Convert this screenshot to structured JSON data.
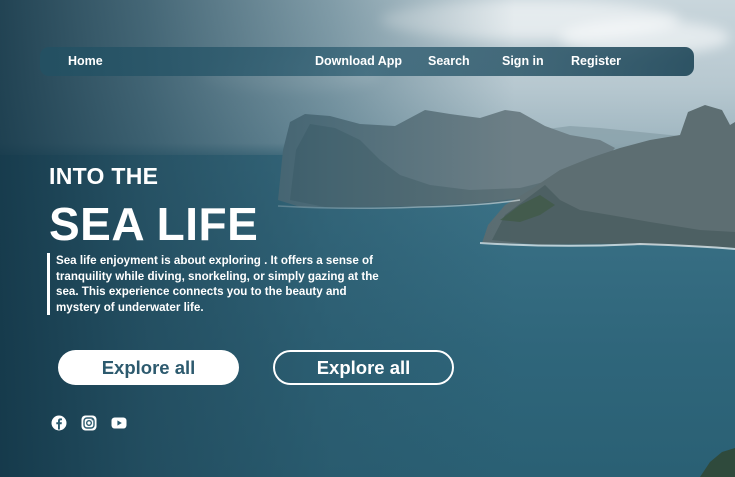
{
  "nav": {
    "home": "Home",
    "download": "Download App",
    "search": "Search",
    "signin": "Sign in",
    "register": "Register"
  },
  "hero": {
    "eyebrow": "INTO THE",
    "headline": "SEA LIFE",
    "description": "Sea life enjoyment is about exploring . It offers a sense of tranquility while diving, snorkeling, or simply gazing at the sea. This experience connects you to the beauty and mystery of underwater life."
  },
  "buttons": {
    "primary": "Explore all",
    "secondary": "Explore all"
  },
  "social": [
    "facebook-icon",
    "instagram-icon",
    "youtube-icon"
  ],
  "colors": {
    "accent_text": "#2d5a6e",
    "sea": "#2f667b",
    "white": "#ffffff"
  }
}
